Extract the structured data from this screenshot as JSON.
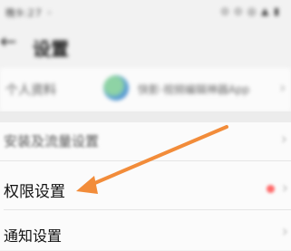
{
  "status_bar": {
    "left_text": "晚9:27 ◦",
    "right_text": "⊙ ⊙ ◎ ▲ ▮"
  },
  "nav": {
    "back_glyph": "←",
    "title": "设置"
  },
  "app_row": {
    "label": "个人资料",
    "name": "快影·视频编辑神器App",
    "chevron": "›"
  },
  "settings": {
    "items": [
      {
        "label": "安装及流量设置",
        "chevron": "›"
      },
      {
        "label": "权限设置",
        "chevron": "›"
      },
      {
        "label": "通知设置",
        "chevron": "›"
      }
    ]
  },
  "colors": {
    "arrow": "#f28c3a",
    "badge": "#ff6a6a"
  }
}
